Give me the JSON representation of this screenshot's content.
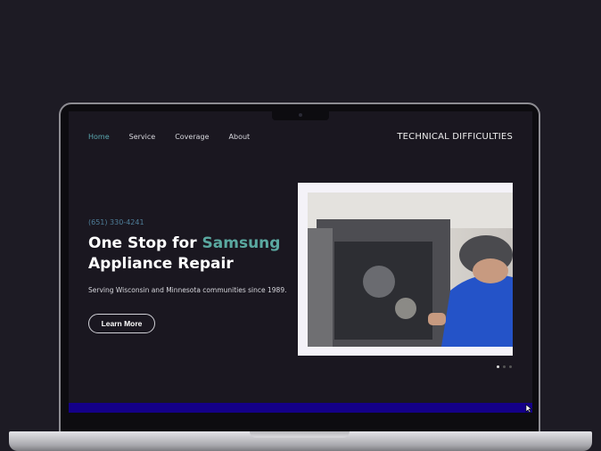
{
  "nav": {
    "items": [
      "Home",
      "Service",
      "Coverage",
      "About"
    ],
    "active": "Home"
  },
  "brand": "TECHNICAL DIFFICULTIES",
  "hero": {
    "phone": "(651) 330-4241",
    "title_a": "One Stop for ",
    "title_accent": "Samsung",
    "title_b": "Appliance Repair",
    "subtitle": "Serving Wisconsin and Minnesota communities since 1989.",
    "cta": "Learn More"
  },
  "carousel": {
    "slides": 3,
    "active": 1
  },
  "colors": {
    "accent": "#5aa8a0",
    "bar": "#140088"
  }
}
